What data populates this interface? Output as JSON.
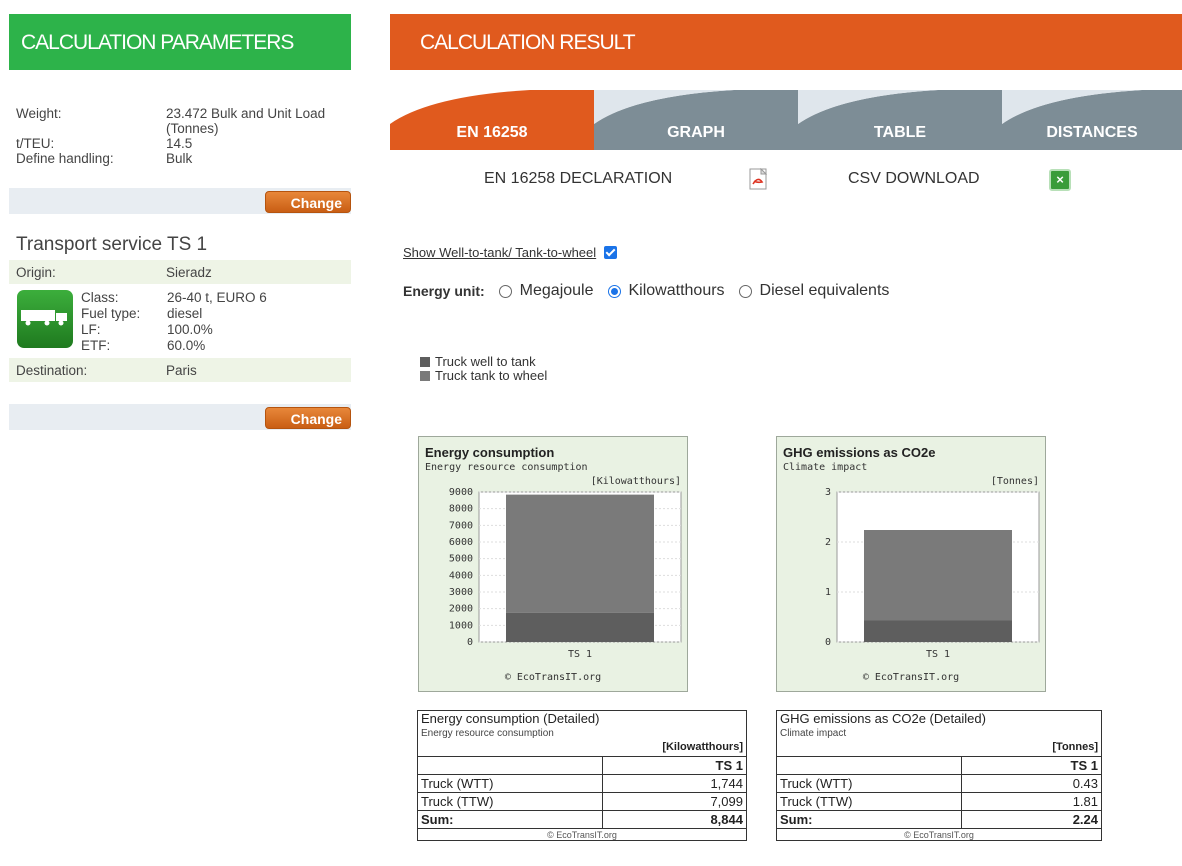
{
  "left": {
    "header": "CALCULATION PARAMETERS",
    "params": [
      {
        "label": "Weight:",
        "value": "23.472 Bulk and Unit Load (Tonnes)"
      },
      {
        "label": "t/TEU:",
        "value": "14.5"
      },
      {
        "label": "Define handling:",
        "value": "Bulk"
      }
    ],
    "change_label": "Change",
    "ts_title": "Transport service TS 1",
    "origin_label": "Origin:",
    "origin_value": "Sieradz",
    "vehicle": [
      {
        "label": "Class:",
        "value": "26-40 t, EURO 6"
      },
      {
        "label": "Fuel type:",
        "value": "diesel"
      },
      {
        "label": "LF:",
        "value": "100.0%"
      },
      {
        "label": "ETF:",
        "value": "60.0%"
      }
    ],
    "destination_label": "Destination:",
    "destination_value": "Paris",
    "change_label2": "Change"
  },
  "right": {
    "header": "CALCULATION RESULT",
    "tabs": [
      "EN 16258",
      "GRAPH",
      "TABLE",
      "DISTANCES"
    ],
    "active_tab": "EN 16258",
    "declaration_label": "EN 16258 DECLARATION",
    "csv_label": "CSV DOWNLOAD",
    "wtt_link": "Show Well-to-tank/ Tank-to-wheel",
    "energy_unit_label": "Energy unit:",
    "energy_units": [
      "Megajoule",
      "Kilowatthours",
      "Diesel equivalents"
    ],
    "energy_unit_selected": "Kilowatthours",
    "legend": [
      "Truck well to tank",
      "Truck tank to wheel"
    ]
  },
  "colors": {
    "green_header": "#2db34a",
    "orange_header": "#e05a1e",
    "tab_active": "#e05a1e",
    "tab_inactive": "#7d8d96",
    "wtt_color": "#5e5e5e",
    "ttw_color": "#7a7a7a"
  },
  "chart_data": [
    {
      "type": "bar",
      "title": "Energy consumption",
      "subtitle": "Energy resource consumption",
      "unit": "[Kilowatthours]",
      "categories": [
        "TS 1"
      ],
      "series": [
        {
          "name": "Truck well to tank",
          "values": [
            1744
          ]
        },
        {
          "name": "Truck tank to wheel",
          "values": [
            7099
          ]
        }
      ],
      "ylim": [
        0,
        9000
      ],
      "yticks": [
        0,
        1000,
        2000,
        3000,
        4000,
        5000,
        6000,
        7000,
        8000,
        9000
      ],
      "footer": "© EcoTransIT.org",
      "stacked": true
    },
    {
      "type": "bar",
      "title": "GHG emissions as CO2e",
      "subtitle": "Climate impact",
      "unit": "[Tonnes]",
      "categories": [
        "TS 1"
      ],
      "series": [
        {
          "name": "Truck well to tank",
          "values": [
            0.43
          ]
        },
        {
          "name": "Truck tank to wheel",
          "values": [
            1.81
          ]
        }
      ],
      "ylim": [
        0,
        3
      ],
      "yticks": [
        0,
        1,
        2,
        3
      ],
      "footer": "© EcoTransIT.org",
      "stacked": true
    }
  ],
  "tables": [
    {
      "title": "Energy consumption (Detailed)",
      "subtitle": "Energy resource consumption",
      "unit": "[Kilowatthours]",
      "col": "TS 1",
      "rows": [
        {
          "label": "Truck (WTT)",
          "value": "1,744"
        },
        {
          "label": "Truck (TTW)",
          "value": "7,099"
        }
      ],
      "sum_label": "Sum:",
      "sum_value": "8,844",
      "footer": "© EcoTransIT.org"
    },
    {
      "title": "GHG emissions as CO2e (Detailed)",
      "subtitle": "Climate impact",
      "unit": "[Tonnes]",
      "col": "TS 1",
      "rows": [
        {
          "label": "Truck (WTT)",
          "value": "0.43"
        },
        {
          "label": "Truck (TTW)",
          "value": "1.81"
        }
      ],
      "sum_label": "Sum:",
      "sum_value": "2.24",
      "footer": "© EcoTransIT.org"
    }
  ]
}
